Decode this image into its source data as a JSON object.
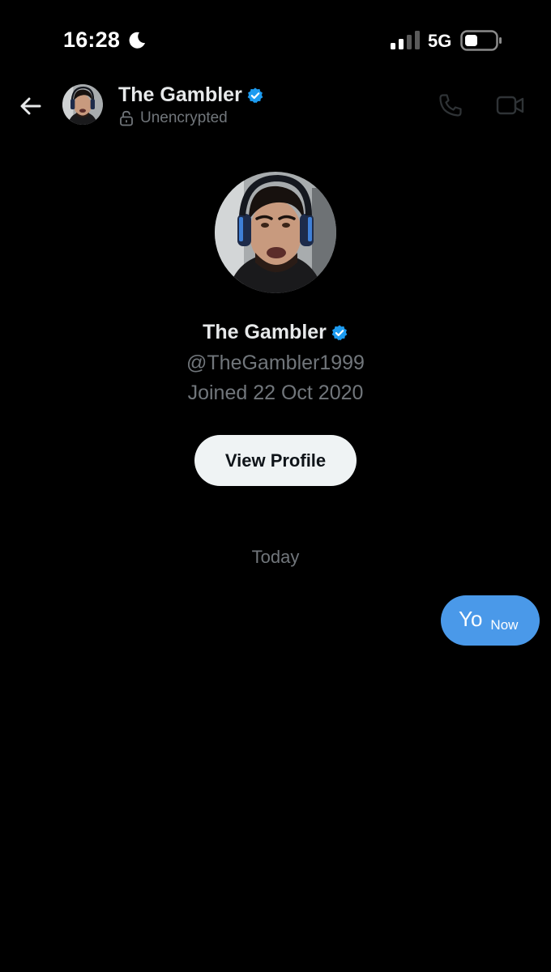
{
  "status_bar": {
    "time": "16:28",
    "network": "5G",
    "icons": [
      "moon-icon",
      "signal-icon",
      "battery-icon"
    ]
  },
  "header": {
    "name": "The Gambler",
    "status": "Unencrypted",
    "icons": [
      "back-arrow-icon",
      "verified-badge-icon",
      "unlock-icon",
      "phone-icon",
      "video-camera-icon"
    ]
  },
  "profile": {
    "name": "The Gambler",
    "handle": "@TheGambler1999",
    "joined": "Joined 22 Oct 2020",
    "button_label": "View Profile"
  },
  "conversation": {
    "date_divider": "Today",
    "messages": [
      {
        "text": "Yo",
        "time": "Now",
        "direction": "outgoing"
      }
    ]
  },
  "colors": {
    "background": "#000000",
    "primary_text": "#e7e9ea",
    "secondary_text": "#71767b",
    "verified": "#1d9bf0",
    "bubble": "#4a99e9",
    "button_bg": "#eff3f4"
  }
}
